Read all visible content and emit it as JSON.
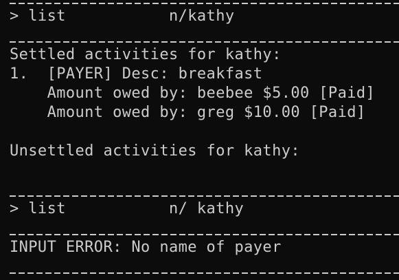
{
  "terminal": {
    "lines": [
      "> list           n/kathy",
      "Settled activities for kathy:",
      "1.  [PAYER] Desc: breakfast",
      "    Amount owed by: beebee $5.00 [Paid]",
      "    Amount owed by: greg $10.00 [Paid]",
      "Unsettled activities for kathy:",
      "> list           n/ kathy",
      "INPUT ERROR: No name of payer"
    ]
  },
  "colors": {
    "background": "#0c0c0c",
    "foreground": "#cccccc"
  }
}
